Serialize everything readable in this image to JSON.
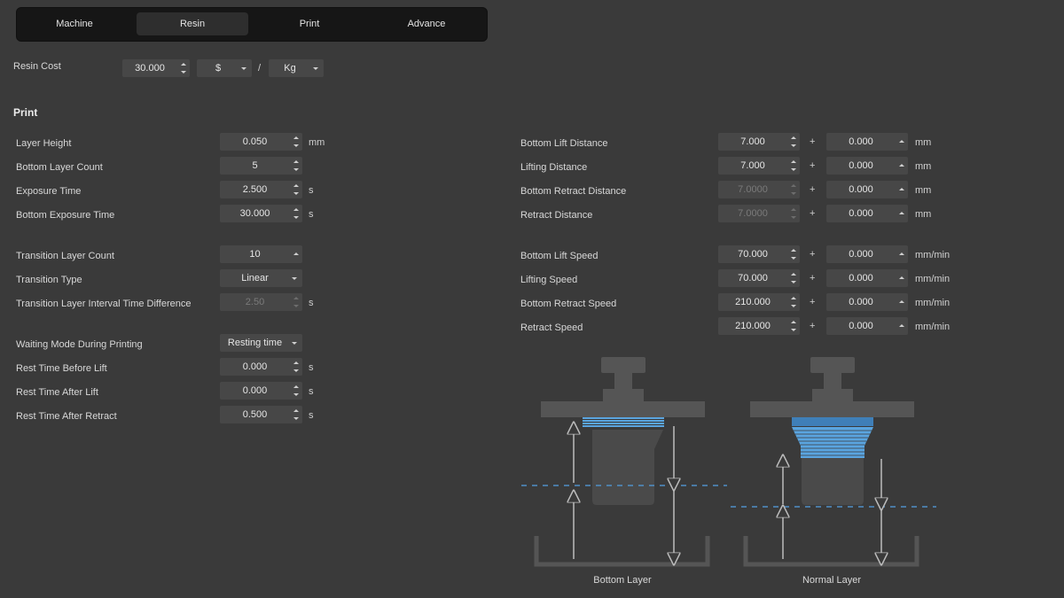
{
  "tabs": [
    {
      "label": "Machine"
    },
    {
      "label": "Resin"
    },
    {
      "label": "Print"
    },
    {
      "label": "Advance"
    }
  ],
  "resin_cost": {
    "label": "Resin Cost",
    "value": "30.000",
    "currency": "$",
    "separator": "/",
    "unit": "Kg"
  },
  "print": {
    "title": "Print",
    "layer_height": {
      "label": "Layer Height",
      "value": "0.050",
      "unit": "mm"
    },
    "bottom_layer_count": {
      "label": "Bottom Layer Count",
      "value": "5"
    },
    "exposure_time": {
      "label": "Exposure Time",
      "value": "2.500",
      "unit": "s"
    },
    "bottom_exposure_time": {
      "label": "Bottom Exposure Time",
      "value": "30.000",
      "unit": "s"
    },
    "transition_layer_count": {
      "label": "Transition Layer Count",
      "value": "10"
    },
    "transition_type": {
      "label": "Transition Type",
      "value": "Linear"
    },
    "transition_interval": {
      "label": "Transition Layer Interval Time Difference",
      "value": "2.50",
      "unit": "s"
    },
    "waiting_mode": {
      "label": "Waiting Mode During Printing",
      "value": "Resting time"
    },
    "rest_before_lift": {
      "label": "Rest Time Before Lift",
      "value": "0.000",
      "unit": "s"
    },
    "rest_after_lift": {
      "label": "Rest Time After Lift",
      "value": "0.000",
      "unit": "s"
    },
    "rest_after_retract": {
      "label": "Rest Time After Retract",
      "value": "0.500",
      "unit": "s"
    }
  },
  "motion": {
    "plus": "+",
    "bottom_lift_distance": {
      "label": "Bottom Lift Distance",
      "value": "7.000",
      "extra": "0.000",
      "unit": "mm"
    },
    "lifting_distance": {
      "label": "Lifting Distance",
      "value": "7.000",
      "extra": "0.000",
      "unit": "mm"
    },
    "bottom_retract_distance": {
      "label": "Bottom Retract Distance",
      "value": "7.0000",
      "extra": "0.000",
      "unit": "mm"
    },
    "retract_distance": {
      "label": "Retract Distance",
      "value": "7.0000",
      "extra": "0.000",
      "unit": "mm"
    },
    "bottom_lift_speed": {
      "label": "Bottom Lift Speed",
      "value": "70.000",
      "extra": "0.000",
      "unit": "mm/min"
    },
    "lifting_speed": {
      "label": "Lifting Speed",
      "value": "70.000",
      "extra": "0.000",
      "unit": "mm/min"
    },
    "bottom_retract_speed": {
      "label": "Bottom Retract Speed",
      "value": "210.000",
      "extra": "0.000",
      "unit": "mm/min"
    },
    "retract_speed": {
      "label": "Retract Speed",
      "value": "210.000",
      "extra": "0.000",
      "unit": "mm/min"
    }
  },
  "diagram": {
    "bottom_caption": "Bottom Layer",
    "normal_caption": "Normal Layer",
    "layer_color": "#5aa5e0",
    "dash_color": "#4f8fc8"
  }
}
